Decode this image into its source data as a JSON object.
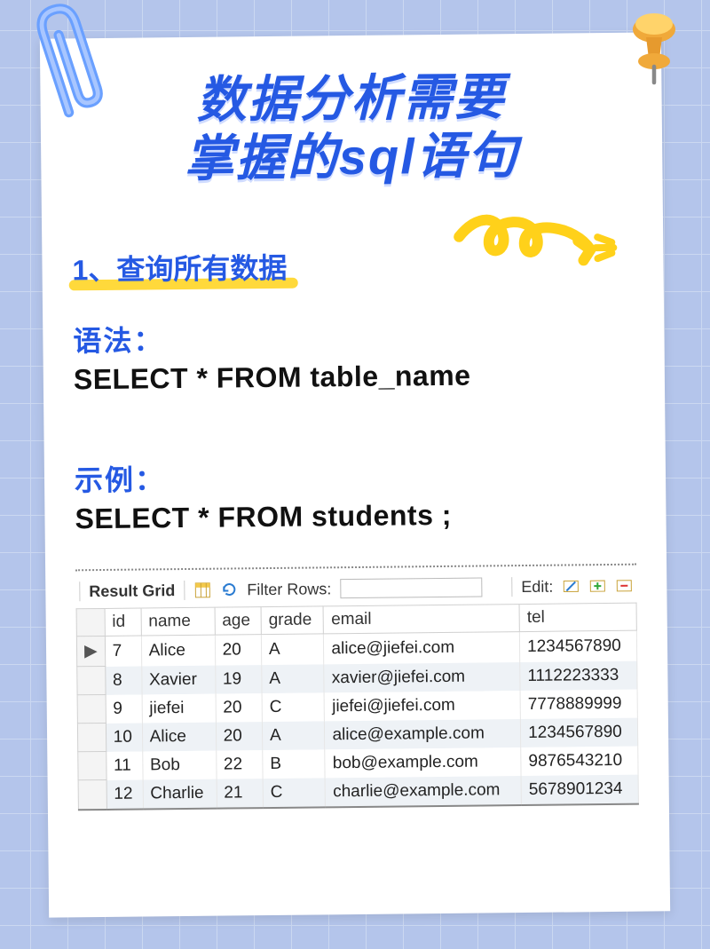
{
  "title_line1": "数据分析需要",
  "title_line2": "掌握的sql语句",
  "section_heading": "1、查询所有数据",
  "syntax_label": "语法：",
  "syntax_code": "SELECT * FROM table_name",
  "example_label": "示例：",
  "example_code": "SELECT * FROM students ;",
  "toolbar": {
    "result_grid": "Result Grid",
    "filter_label": "Filter Rows:",
    "filter_value": "",
    "edit_label": "Edit:"
  },
  "columns": [
    "id",
    "name",
    "age",
    "grade",
    "email",
    "tel"
  ],
  "rows": [
    {
      "cursor": "▶",
      "id": "7",
      "name": "Alice",
      "age": "20",
      "grade": "A",
      "email": "alice@jiefei.com",
      "tel": "1234567890"
    },
    {
      "cursor": "",
      "id": "8",
      "name": "Xavier",
      "age": "19",
      "grade": "A",
      "email": "xavier@jiefei.com",
      "tel": "1112223333"
    },
    {
      "cursor": "",
      "id": "9",
      "name": "jiefei",
      "age": "20",
      "grade": "C",
      "email": "jiefei@jiefei.com",
      "tel": "7778889999"
    },
    {
      "cursor": "",
      "id": "10",
      "name": "Alice",
      "age": "20",
      "grade": "A",
      "email": "alice@example.com",
      "tel": "1234567890"
    },
    {
      "cursor": "",
      "id": "11",
      "name": "Bob",
      "age": "22",
      "grade": "B",
      "email": "bob@example.com",
      "tel": "9876543210"
    },
    {
      "cursor": "",
      "id": "12",
      "name": "Charlie",
      "age": "21",
      "grade": "C",
      "email": "charlie@example.com",
      "tel": "5678901234"
    }
  ]
}
